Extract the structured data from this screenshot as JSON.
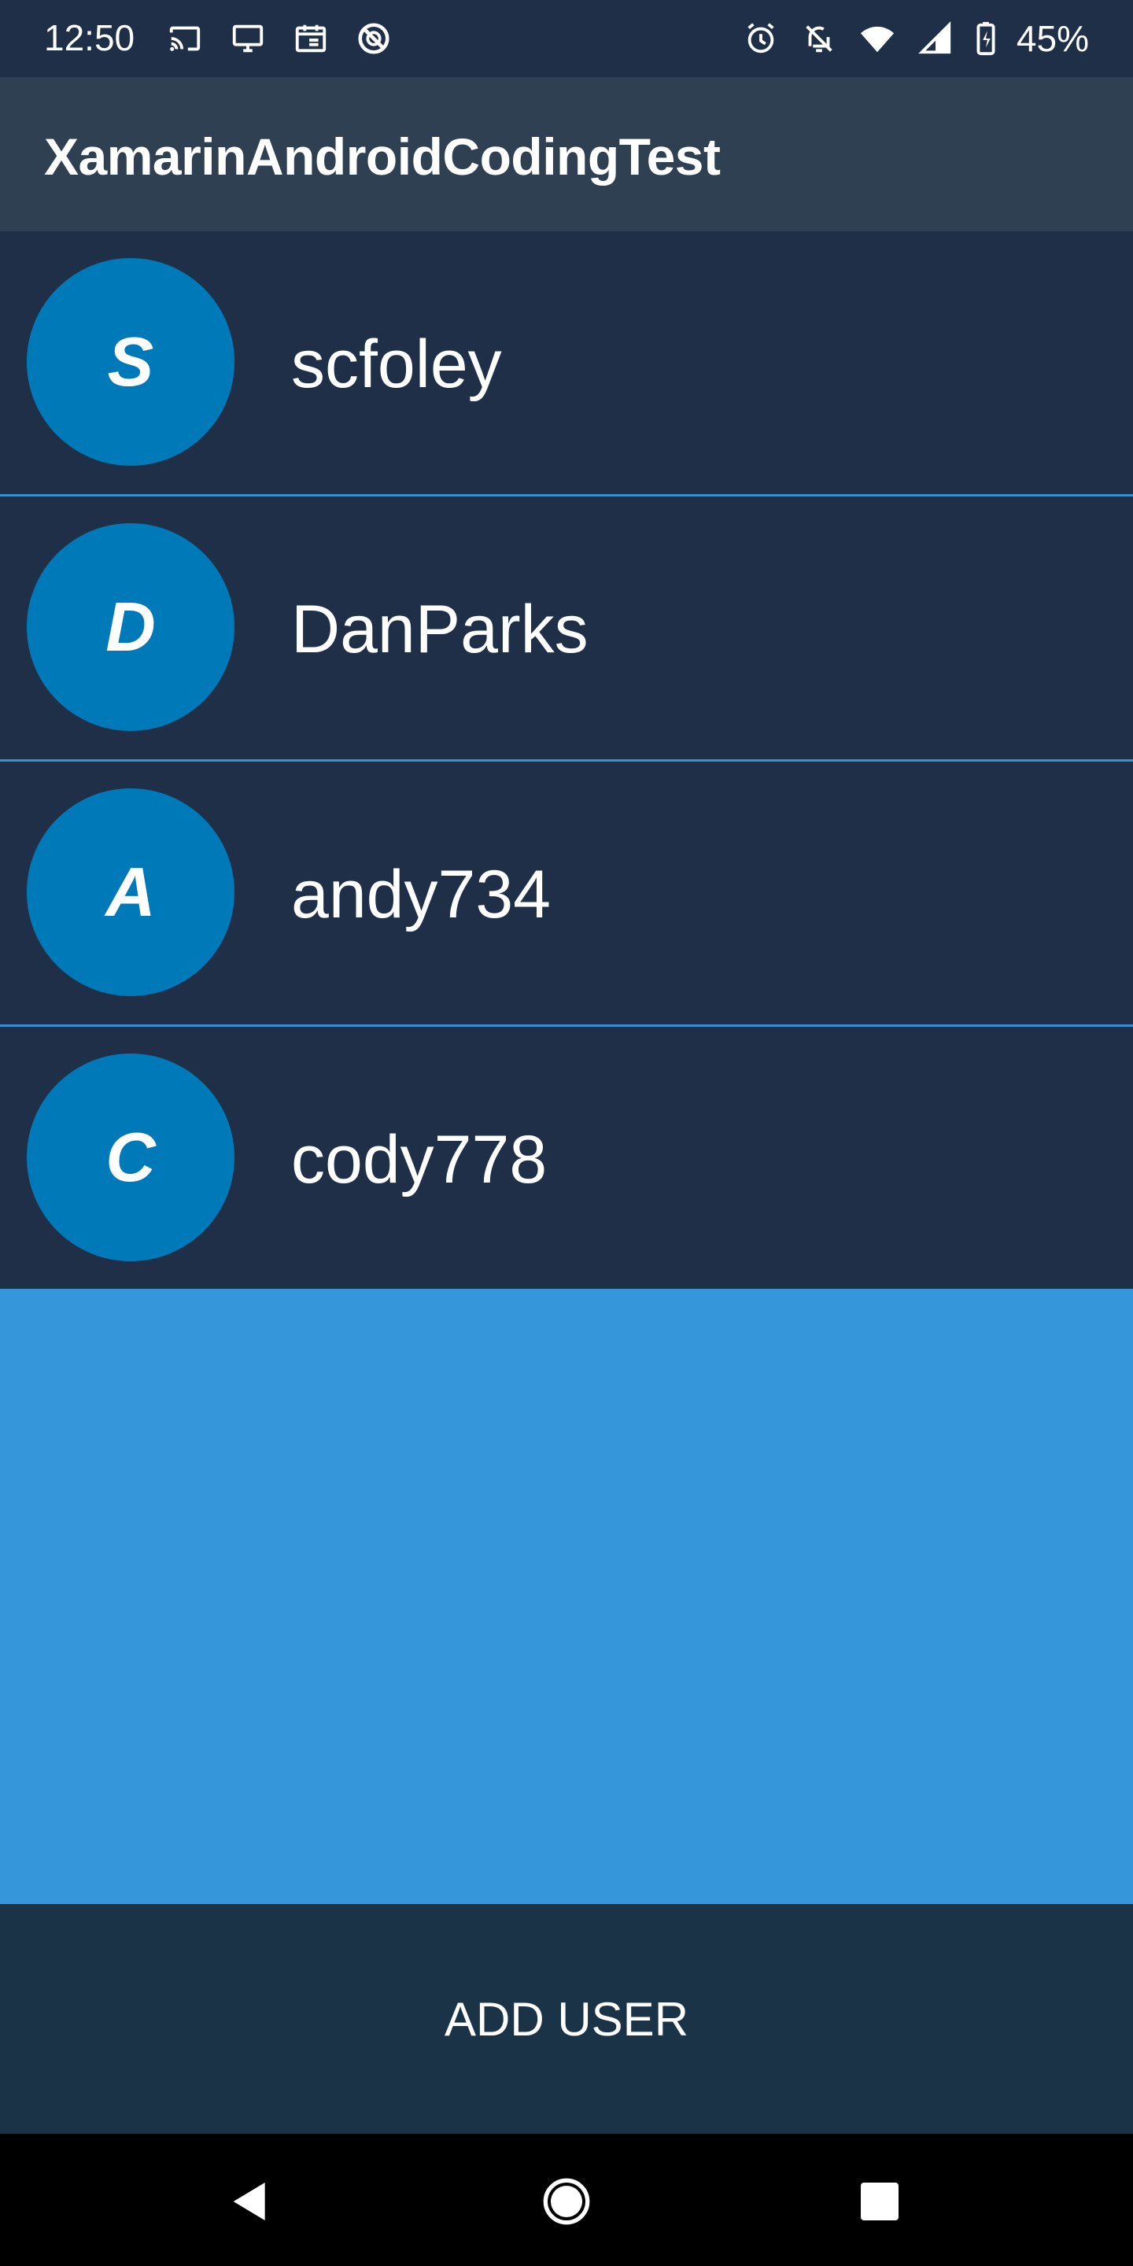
{
  "status_bar": {
    "time": "12:50",
    "battery": "45%",
    "left_icons": [
      "cast-icon",
      "monitor-icon",
      "calendar-icon",
      "sync-off-icon"
    ],
    "right_icons": [
      "alarm-icon",
      "notifications-off-icon",
      "wifi-icon",
      "signal-icon",
      "battery-charging-icon"
    ]
  },
  "app_bar": {
    "title": "XamarinAndroidCodingTest"
  },
  "users": [
    {
      "initial": "S",
      "name": "scfoley"
    },
    {
      "initial": "D",
      "name": "DanParks"
    },
    {
      "initial": "A",
      "name": "andy734"
    },
    {
      "initial": "C",
      "name": "cody778"
    }
  ],
  "actions": {
    "add_user_label": "ADD USER"
  },
  "colors": {
    "status_bar": "#1e2f47",
    "app_bar": "#2f4052",
    "list_background": "#1e2f47",
    "avatar": "#0079b8",
    "divider": "#3a8fd0",
    "empty_area": "#3596da",
    "bottom_bar": "#1b3347"
  }
}
